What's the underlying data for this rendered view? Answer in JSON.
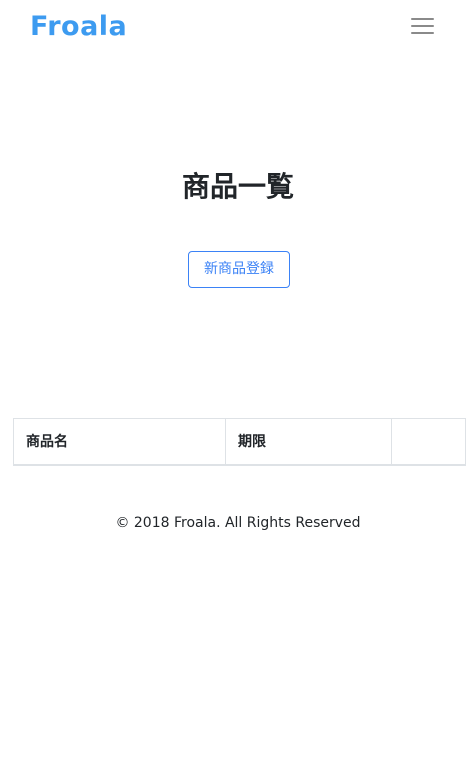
{
  "navbar": {
    "brand": "Froala",
    "toggler_icon": "hamburger-menu-icon"
  },
  "main": {
    "title": "商品一覧",
    "new_button_label": "新商品登録",
    "table": {
      "headers": [
        "商品名",
        "期限",
        ""
      ],
      "rows": []
    }
  },
  "footer": {
    "text": "© 2018 Froala. All Rights Reserved"
  },
  "colors": {
    "brand": "#3d9bf0",
    "primary": "#3b82f6",
    "text": "#212529",
    "border": "#dee2e6"
  }
}
